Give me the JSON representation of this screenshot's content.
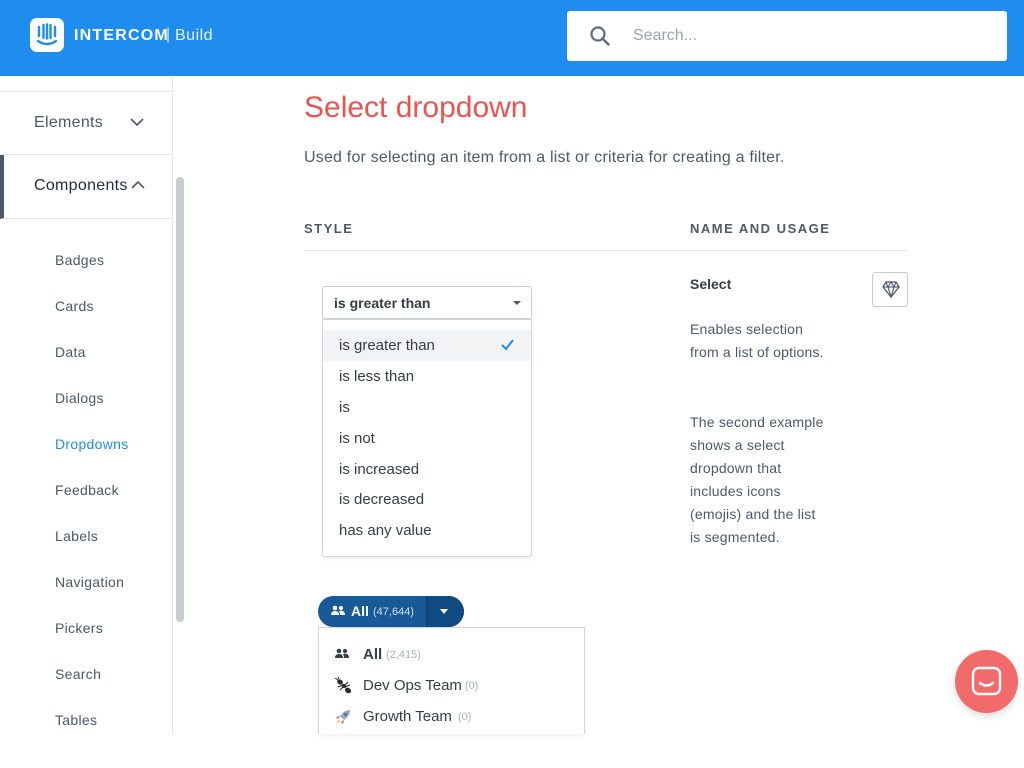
{
  "header": {
    "brand": "INTERCOM",
    "separator": "|",
    "sub": "Build",
    "search_placeholder": "Search..."
  },
  "sidebar": {
    "sections": [
      {
        "label": "Elements",
        "icon": "chevron-down-icon"
      },
      {
        "label": "Components",
        "icon": "chevron-up-icon"
      }
    ],
    "items": [
      "Badges",
      "Cards",
      "Data",
      "Dialogs",
      "Dropdowns",
      "Feedback",
      "Labels",
      "Navigation",
      "Pickers",
      "Search",
      "Tables"
    ],
    "active_item": "Dropdowns"
  },
  "main": {
    "title": "Select dropdown",
    "subtitle": "Used for selecting an item from a list or criteria for creating a filter.",
    "col_style": "STYLE",
    "col_usage": "NAME AND USAGE",
    "select": {
      "value": "is greater than",
      "options": [
        "is greater than",
        "is less than",
        "is",
        "is not",
        "is increased",
        "is decreased",
        "has any value"
      ],
      "selected_index": 0
    },
    "usage": {
      "title": "Select",
      "p1": "Enables selection from a list of options.",
      "p2": "The second example shows a select dropdown that includes icons (emojis) and the list is segmented.",
      "sketch_icon": "diamond-icon"
    },
    "pill": {
      "label": "All",
      "count": "(47,644)",
      "icon": "people-icon"
    },
    "segment_menu": [
      {
        "label": "All",
        "count": "(2,415)",
        "icon": "people-icon",
        "bold": true
      },
      {
        "label": "Dev Ops Team",
        "count": "(0)",
        "icon": "ant-icon",
        "bold": false
      },
      {
        "label": "Growth Team",
        "count": "(0)",
        "icon": "rocket-icon",
        "bold": false
      }
    ]
  },
  "colors": {
    "header_bg": "#1f8ded",
    "title": "#e9544e",
    "active_link": "#1f8ded",
    "pill_bg": "#175a97",
    "launcher_bg": "#f26b6b"
  },
  "launcher": {
    "icon": "chat-icon"
  }
}
